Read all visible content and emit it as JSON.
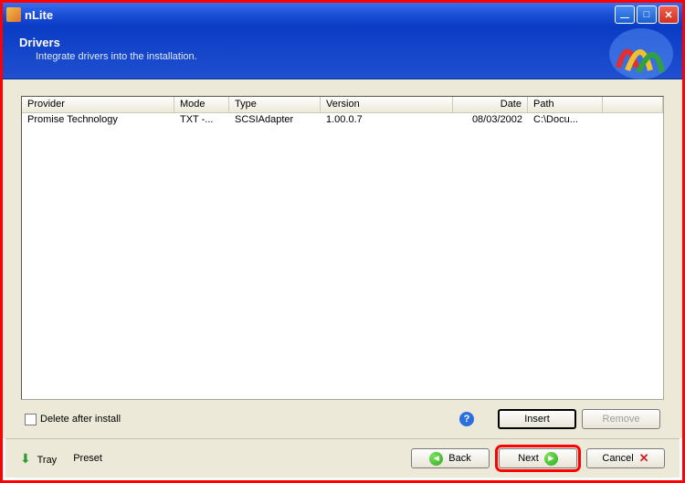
{
  "window": {
    "title": "nLite"
  },
  "header": {
    "title": "Drivers",
    "subtitle": "Integrate drivers into the installation."
  },
  "columns": {
    "provider": "Provider",
    "mode": "Mode",
    "type": "Type",
    "version": "Version",
    "date": "Date",
    "path": "Path"
  },
  "rows": [
    {
      "provider": "Promise Technology",
      "mode": "TXT -...",
      "type": "SCSIAdapter",
      "version": "1.00.0.7",
      "date": "08/03/2002",
      "path": "C:\\Docu..."
    }
  ],
  "controls": {
    "delete_after": "Delete after install",
    "insert": "Insert",
    "remove": "Remove",
    "help": "?"
  },
  "footer": {
    "tray": "Tray",
    "preset": "Preset",
    "back": "Back",
    "next": "Next",
    "cancel": "Cancel"
  }
}
